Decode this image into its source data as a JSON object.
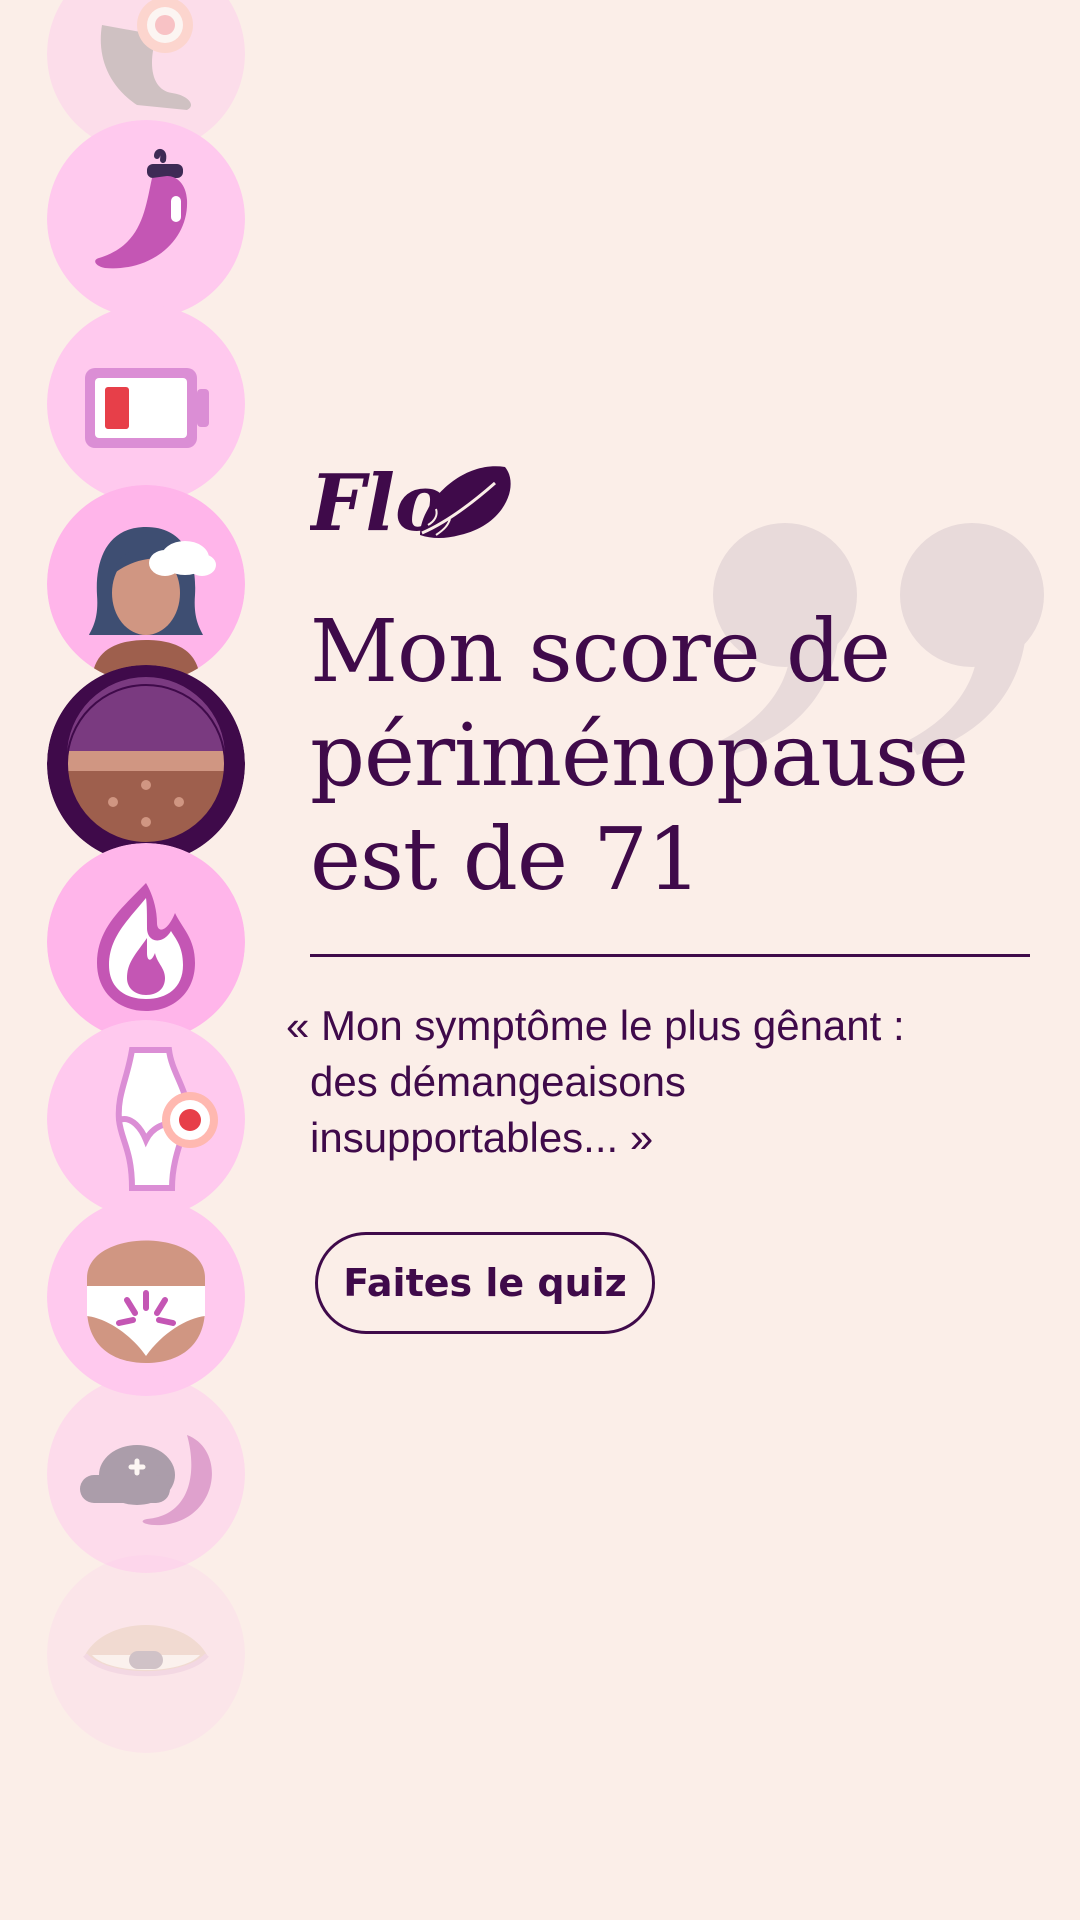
{
  "brand": {
    "logo_text": "Flo"
  },
  "headline": {
    "line1": "Mon score de",
    "line2": "périménopause",
    "line3": "est de 71"
  },
  "testimonial": {
    "line1": "« Mon symptôme le plus gênant :",
    "line2": "des démangeaisons",
    "line3": "insupportables... »"
  },
  "cta": {
    "label": "Faites le quiz"
  },
  "symptom_icons": [
    "joint-pain-foot-icon",
    "hot-pepper-icon",
    "low-battery-icon",
    "brain-fog-woman-icon",
    "itchy-skin-icon",
    "hot-flash-flame-icon",
    "joint-pain-knee-icon",
    "pelvic-pain-icon",
    "sleep-cloud-moon-icon",
    "dry-eye-icon"
  ],
  "colors": {
    "background": "#FBEEE8",
    "brand_purple": "#3F0A4A",
    "icon_pink": "#FFB5EA",
    "quote_mark": "#E8DADA"
  }
}
